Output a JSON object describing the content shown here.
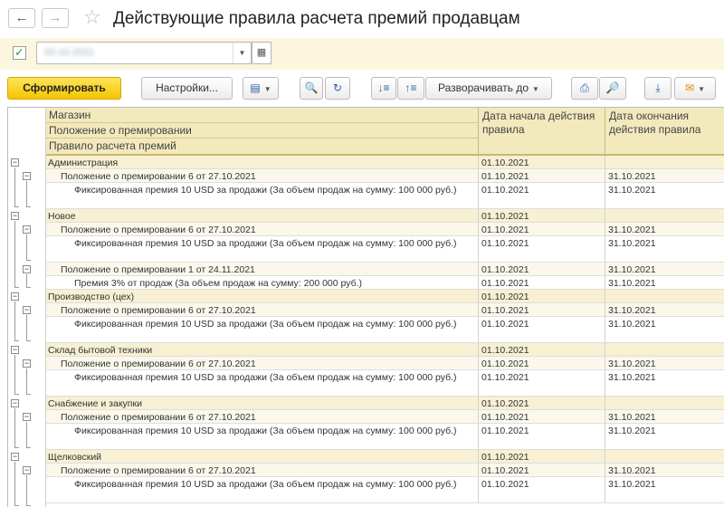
{
  "window": {
    "title": "Действующие правила расчета премий продавцам",
    "back_icon": "←",
    "forward_icon": "→",
    "favorite_icon": "☆"
  },
  "period": {
    "checkbox_mark": "✓",
    "value": "00.10.2021",
    "dropdown_icon": "▼",
    "calendar_icon": "▦"
  },
  "toolbar": {
    "generate_label": "Сформировать",
    "settings_label": "Настройки...",
    "expand_label": "Разворачивать до",
    "icons": {
      "variant": "▤",
      "search": "🔍",
      "search_refresh": "↻",
      "sort_desc": "↓≡",
      "sort_asc": "↑≡",
      "print": "⎙",
      "preview": "🔎",
      "download": "⤓",
      "mail": "✉",
      "caret": "▼"
    }
  },
  "report": {
    "header": {
      "group_levels": [
        "Магазин",
        "Положение о премировании",
        "Правило расчета премий"
      ],
      "col_start": "Дата начала действия правила",
      "col_end": "Дата окончания действия правила"
    },
    "rows": [
      {
        "level": 0,
        "text": "Администрация",
        "start": "01.10.2021",
        "end": ""
      },
      {
        "level": 1,
        "text": "Положение о премировании 6   от 27.10.2021",
        "start": "01.10.2021",
        "end": "31.10.2021"
      },
      {
        "level": 2,
        "text": "Фиксированная премия 10 USD за продажи (За объем продаж на сумму: 100 000 руб.)",
        "start": "01.10.2021",
        "end": "31.10.2021"
      },
      {
        "level": 0,
        "text": "Новое",
        "start": "01.10.2021",
        "end": ""
      },
      {
        "level": 1,
        "text": "Положение о премировании 6   от 27.10.2021",
        "start": "01.10.2021",
        "end": "31.10.2021"
      },
      {
        "level": 2,
        "text": "Фиксированная премия 10 USD за продажи (За объем продаж на сумму: 100 000 руб.)",
        "start": "01.10.2021",
        "end": "31.10.2021"
      },
      {
        "level": 1,
        "text": "Положение о премировании 1 от 24.11.2021",
        "start": "01.10.2021",
        "end": "31.10.2021"
      },
      {
        "level": 2,
        "text": "Премия 3% от продаж (За объем продаж на сумму: 200 000 руб.)",
        "start": "01.10.2021",
        "end": "31.10.2021"
      },
      {
        "level": 0,
        "text": "Производство (цех)",
        "start": "01.10.2021",
        "end": ""
      },
      {
        "level": 1,
        "text": "Положение о премировании 6   от 27.10.2021",
        "start": "01.10.2021",
        "end": "31.10.2021"
      },
      {
        "level": 2,
        "text": "Фиксированная премия 10 USD за продажи (За объем продаж на сумму: 100 000 руб.)",
        "start": "01.10.2021",
        "end": "31.10.2021"
      },
      {
        "level": 0,
        "text": "Склад бытовой техники",
        "start": "01.10.2021",
        "end": ""
      },
      {
        "level": 1,
        "text": "Положение о премировании 6   от 27.10.2021",
        "start": "01.10.2021",
        "end": "31.10.2021"
      },
      {
        "level": 2,
        "text": "Фиксированная премия 10 USD за продажи (За объем продаж на сумму: 100 000 руб.)",
        "start": "01.10.2021",
        "end": "31.10.2021"
      },
      {
        "level": 0,
        "text": "Снабжение и закупки",
        "start": "01.10.2021",
        "end": ""
      },
      {
        "level": 1,
        "text": "Положение о премировании 6   от 27.10.2021",
        "start": "01.10.2021",
        "end": "31.10.2021"
      },
      {
        "level": 2,
        "text": "Фиксированная премия 10 USD за продажи (За объем продаж на сумму: 100 000 руб.)",
        "start": "01.10.2021",
        "end": "31.10.2021"
      },
      {
        "level": 0,
        "text": "Щелковский",
        "start": "01.10.2021",
        "end": ""
      },
      {
        "level": 1,
        "text": "Положение о премировании 6   от 27.10.2021",
        "start": "01.10.2021",
        "end": "31.10.2021"
      },
      {
        "level": 2,
        "text": "Фиксированная премия 10 USD за продажи (За объем продаж на сумму: 100 000 руб.)",
        "start": "01.10.2021",
        "end": "31.10.2021"
      }
    ],
    "tree_toggle_icon": "−"
  }
}
